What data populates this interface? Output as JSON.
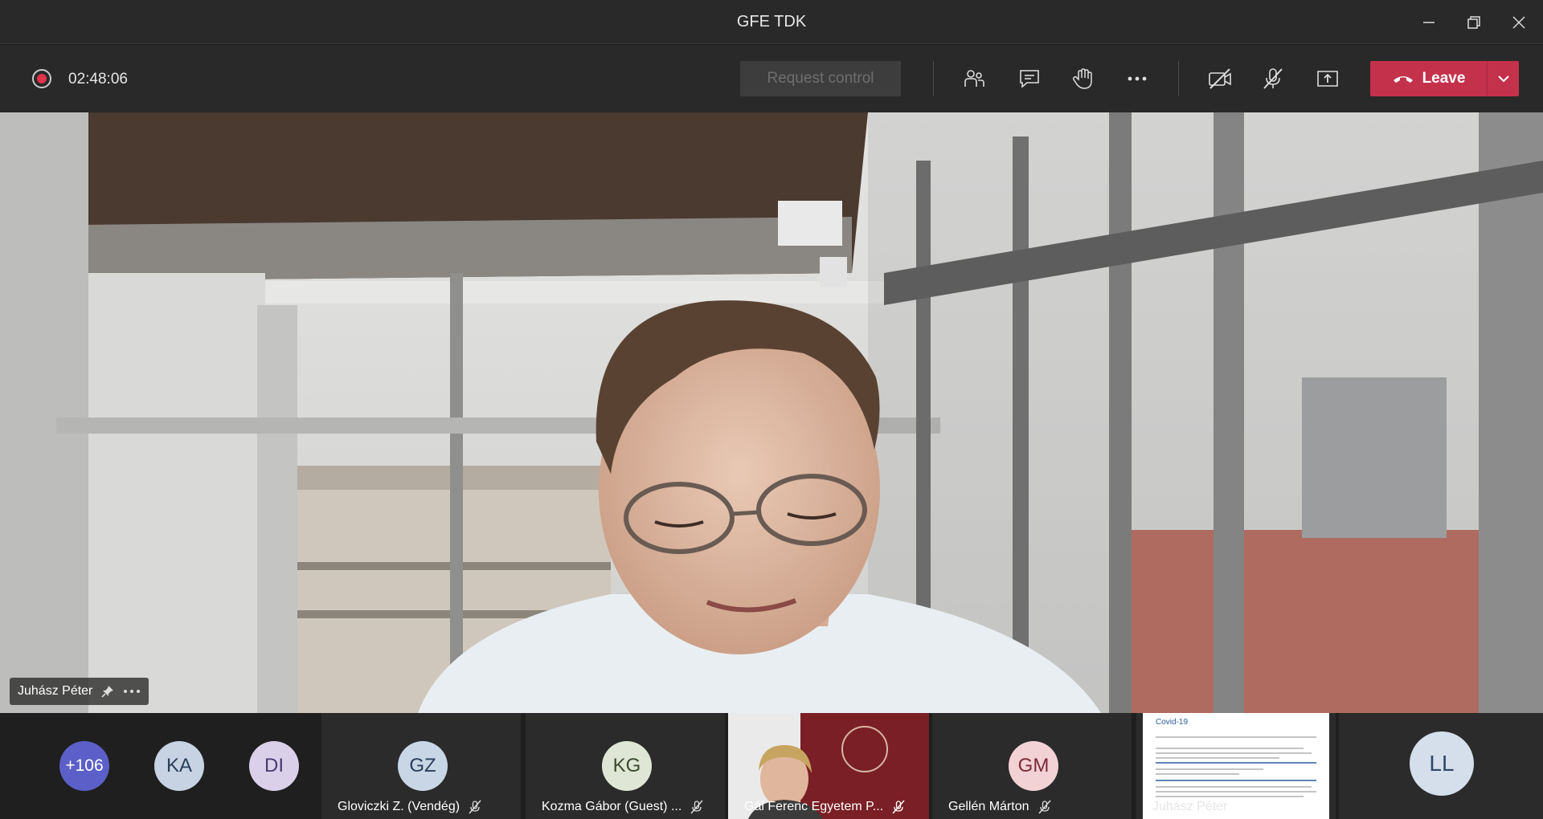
{
  "window": {
    "title": "GFE TDK"
  },
  "toolbar": {
    "timer": "02:48:06",
    "request_control_label": "Request control",
    "leave_label": "Leave"
  },
  "main_video": {
    "participant_name": "Juhász Péter"
  },
  "overflow": {
    "count": "+106"
  },
  "participants": [
    {
      "initials": "KA"
    },
    {
      "initials": "DI"
    },
    {
      "initials": "GZ",
      "name": "Gloviczki Z. (Vendég)"
    },
    {
      "initials": "KG",
      "name": "Kozma Gábor (Guest) ..."
    },
    {
      "name": "Gál Ferenc Egyetem P..."
    },
    {
      "initials": "GM",
      "name": "Gellén Márton"
    },
    {
      "name": "Juhász Péter",
      "slide_title": "Covid-19"
    },
    {
      "initials": "LL"
    }
  ],
  "colors": {
    "leave": "#c4314b",
    "overflow_avatar": "#5b5fc7",
    "recording": "#e3324c"
  }
}
